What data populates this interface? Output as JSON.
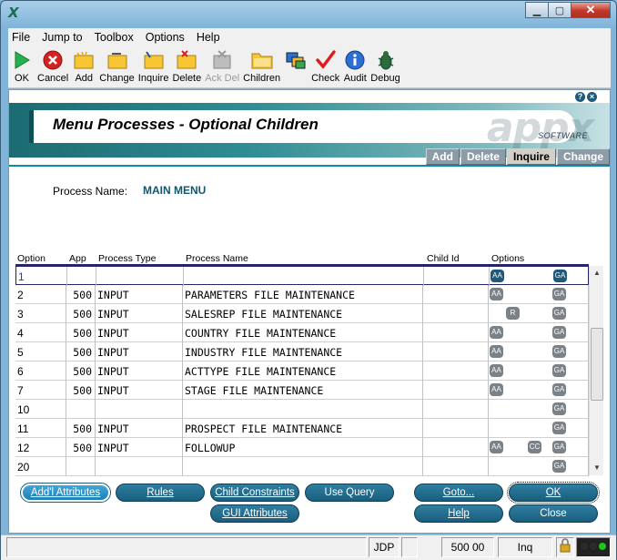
{
  "window": {
    "title": ""
  },
  "menu": [
    "File",
    "Jump to",
    "Toolbox",
    "Options",
    "Help"
  ],
  "toolbar": [
    {
      "label": "OK",
      "icon": "play-icon",
      "disabled": false
    },
    {
      "label": "Cancel",
      "icon": "stop-icon",
      "disabled": false
    },
    {
      "label": "Add",
      "icon": "add-folder-icon",
      "disabled": false
    },
    {
      "label": "Change",
      "icon": "change-folder-icon",
      "disabled": false
    },
    {
      "label": "Inquire",
      "icon": "inquire-folder-icon",
      "disabled": false
    },
    {
      "label": "Delete",
      "icon": "delete-folder-icon",
      "disabled": false
    },
    {
      "label": "Ack Del",
      "icon": "ack-delete-icon",
      "disabled": true
    },
    {
      "label": "Children",
      "icon": "folder-icon",
      "disabled": false
    },
    {
      "label": "",
      "icon": "cascade-windows-icon",
      "disabled": false
    },
    {
      "label": "Check",
      "icon": "checkmark-icon",
      "disabled": false
    },
    {
      "label": "Audit",
      "icon": "info-icon",
      "disabled": false
    },
    {
      "label": "Debug",
      "icon": "bug-icon",
      "disabled": false
    }
  ],
  "banner": {
    "title": "Menu Processes - Optional Children",
    "logo": "appx",
    "logo_sub": "SOFTWARE",
    "help_icon": "?",
    "close_icon": "×"
  },
  "mode_tabs": [
    {
      "label": "Add",
      "active": false
    },
    {
      "label": "Delete",
      "active": false
    },
    {
      "label": "Inquire",
      "active": true
    },
    {
      "label": "Change",
      "active": false
    }
  ],
  "process": {
    "label": "Process Name:",
    "value": "MAIN MENU"
  },
  "table": {
    "headers": [
      "Option",
      "App",
      "Process Type",
      "Process Name",
      "Child Id",
      "Options"
    ],
    "rows": [
      {
        "option": "1",
        "app": "",
        "type": "",
        "name": "",
        "child": "",
        "badges": [
          {
            "t": "AA",
            "pos": 0,
            "on": true
          },
          {
            "t": "GA",
            "pos": 3,
            "on": true
          }
        ]
      },
      {
        "option": "2",
        "app": "500",
        "type": "INPUT",
        "name": "PARAMETERS FILE MAINTENANCE",
        "child": "",
        "badges": [
          {
            "t": "AA",
            "pos": 0
          },
          {
            "t": "GA",
            "pos": 3
          }
        ]
      },
      {
        "option": "3",
        "app": "500",
        "type": "INPUT",
        "name": "SALESREP FILE MAINTENANCE",
        "child": "",
        "badges": [
          {
            "t": "R",
            "pos": 1
          },
          {
            "t": "GA",
            "pos": 3
          }
        ]
      },
      {
        "option": "4",
        "app": "500",
        "type": "INPUT",
        "name": "COUNTRY FILE MAINTENANCE",
        "child": "",
        "badges": [
          {
            "t": "AA",
            "pos": 0
          },
          {
            "t": "GA",
            "pos": 3
          }
        ]
      },
      {
        "option": "5",
        "app": "500",
        "type": "INPUT",
        "name": "INDUSTRY FILE MAINTENANCE",
        "child": "",
        "badges": [
          {
            "t": "AA",
            "pos": 0
          },
          {
            "t": "GA",
            "pos": 3
          }
        ]
      },
      {
        "option": "6",
        "app": "500",
        "type": "INPUT",
        "name": "ACTTYPE FILE MAINTENANCE",
        "child": "",
        "badges": [
          {
            "t": "AA",
            "pos": 0
          },
          {
            "t": "GA",
            "pos": 3
          }
        ]
      },
      {
        "option": "7",
        "app": "500",
        "type": "INPUT",
        "name": "STAGE FILE MAINTENANCE",
        "child": "",
        "badges": [
          {
            "t": "AA",
            "pos": 0
          },
          {
            "t": "GA",
            "pos": 3
          }
        ]
      },
      {
        "option": "10",
        "app": "",
        "type": "",
        "name": "",
        "child": "",
        "badges": [
          {
            "t": "GA",
            "pos": 3
          }
        ]
      },
      {
        "option": "11",
        "app": "500",
        "type": "INPUT",
        "name": "PROSPECT FILE MAINTENANCE",
        "child": "",
        "badges": [
          {
            "t": "GA",
            "pos": 3
          }
        ]
      },
      {
        "option": "12",
        "app": "500",
        "type": "INPUT",
        "name": "FOLLOWUP",
        "child": "",
        "badges": [
          {
            "t": "AA",
            "pos": 0
          },
          {
            "t": "CC",
            "pos": 2
          },
          {
            "t": "GA",
            "pos": 3
          }
        ]
      },
      {
        "option": "20",
        "app": "",
        "type": "",
        "name": "",
        "child": "",
        "badges": [
          {
            "t": "GA",
            "pos": 3
          }
        ]
      }
    ]
  },
  "buttons": {
    "addl_attributes": "Add'l Attributes",
    "rules": "Rules",
    "child_constraints": "Child Constraints",
    "use_query": "Use Query",
    "gui_attributes": "GUI Attributes",
    "goto": "Goto...",
    "help": "Help",
    "ok": "OK",
    "close": "Close"
  },
  "status": {
    "user": "JDP",
    "app": "500 00",
    "mode": "Inq"
  }
}
